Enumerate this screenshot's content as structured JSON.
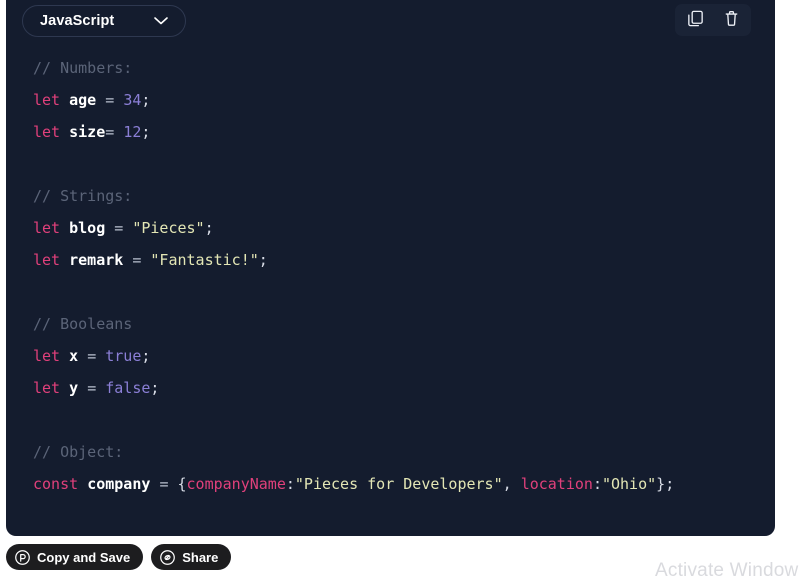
{
  "card": {
    "language_select": {
      "value": "JavaScript",
      "chevron_icon": "chevron-down-icon"
    },
    "actions": {
      "copy_icon": "copy-icon",
      "delete_icon": "trash-icon"
    }
  },
  "code": {
    "language": "JavaScript",
    "lines": [
      {
        "type": "comment",
        "text": "// Numbers:"
      },
      {
        "type": "code",
        "text": "let age = 34;"
      },
      {
        "type": "code",
        "text": "let size= 12;"
      },
      {
        "type": "blank",
        "text": ""
      },
      {
        "type": "comment",
        "text": "// Strings:"
      },
      {
        "type": "code",
        "text": "let blog = \"Pieces\";"
      },
      {
        "type": "code",
        "text": "let remark = \"Fantastic!\";"
      },
      {
        "type": "blank",
        "text": ""
      },
      {
        "type": "comment",
        "text": "// Booleans"
      },
      {
        "type": "code",
        "text": "let x = true;"
      },
      {
        "type": "code",
        "text": "let y = false;"
      },
      {
        "type": "blank",
        "text": ""
      },
      {
        "type": "comment",
        "text": "// Object:"
      },
      {
        "type": "code",
        "text": "const company = {companyName:\"Pieces for Developers\", location:\"Ohio\"};"
      }
    ],
    "tokens": {
      "l1_comment": "// Numbers:",
      "l2_kw": "let",
      "l2_var": "age",
      "l2_eq": "=",
      "l2_num": "34",
      "l2_semi": ";",
      "l3_kw": "let",
      "l3_var": "size",
      "l3_eq": "=",
      "l3_num": "12",
      "l3_semi": ";",
      "l5_comment": "// Strings:",
      "l6_kw": "let",
      "l6_var": "blog",
      "l6_eq": "=",
      "l6_str": "\"Pieces\"",
      "l6_semi": ";",
      "l7_kw": "let",
      "l7_var": "remark",
      "l7_eq": "=",
      "l7_str": "\"Fantastic!\"",
      "l7_semi": ";",
      "l9_comment": "// Booleans",
      "l10_kw": "let",
      "l10_var": "x",
      "l10_eq": "=",
      "l10_bool": "true",
      "l10_semi": ";",
      "l11_kw": "let",
      "l11_var": "y",
      "l11_eq": "=",
      "l11_bool": "false",
      "l11_semi": ";",
      "l13_comment": "// Object:",
      "l14_kw": "const",
      "l14_var": "company",
      "l14_eq": "=",
      "l14_brace_open": "{",
      "l14_prop1": "companyName",
      "l14_colon1": ":",
      "l14_str1": "\"Pieces for Developers\"",
      "l14_comma": ",",
      "l14_prop2": "location",
      "l14_colon2": ":",
      "l14_str2": "\"Ohio\"",
      "l14_brace_close": "}",
      "l14_semi": ";"
    }
  },
  "bottom_bar": {
    "copy_and_save": {
      "label": "Copy and Save",
      "icon": "pieces-logo-icon"
    },
    "share": {
      "label": "Share",
      "icon": "link-icon"
    }
  },
  "watermark": {
    "text": "Activate Window"
  },
  "colors": {
    "card_bg": "#141c2e",
    "page_bg": "#ffffff",
    "keyword": "#e0407b",
    "string": "#e3e6b5",
    "number": "#8b7fd6",
    "comment": "#5b6478",
    "variable": "#ffffff",
    "pill_bg": "#1d1d1f"
  }
}
